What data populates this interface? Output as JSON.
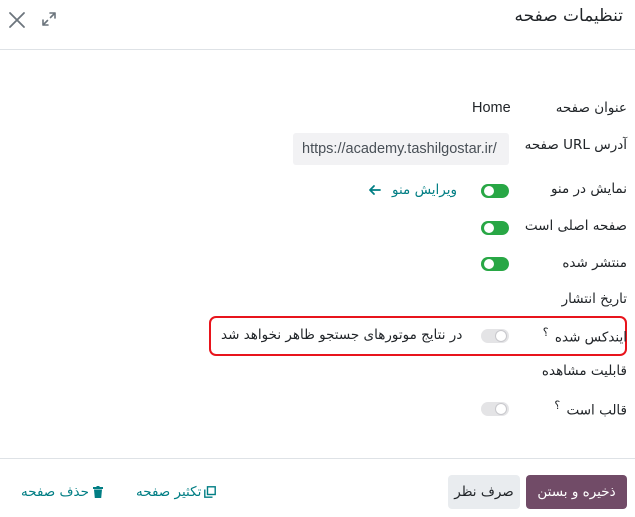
{
  "dialog": {
    "title": "تنظیمات صفحه"
  },
  "fields": {
    "page_title_label": "عنوان صفحه",
    "page_title_value": "Home",
    "url_label": "آدرس URL صفحه",
    "url_value": "https://academy.tashilgostar.ir/",
    "show_in_menu_label": "نمایش در منو",
    "show_in_menu_on": true,
    "edit_menu_label": "ویرایش منو",
    "homepage_label": "صفحه اصلی است",
    "homepage_on": true,
    "published_label": "منتشر شده",
    "published_on": true,
    "publish_date_label": "تاریخ انتشار",
    "indexed_label": "ایندکس شده",
    "indexed_hint": "؟",
    "indexed_on": false,
    "indexed_description": "در نتایج موتورهای جستجو ظاهر نخواهد شد",
    "visibility_label": "قابلیت مشاهده",
    "template_label": "قالب است",
    "template_hint": "؟",
    "template_on": false
  },
  "footer": {
    "save_close_label": "ذخیره و بستن",
    "discard_label": "صرف نظر",
    "duplicate_label": "تکثیر صفحه",
    "delete_label": "حذف صفحه"
  },
  "colors": {
    "primary": "#714b67",
    "toggle_on": "#28a745",
    "link": "#017e84",
    "highlight": "#e8141c"
  },
  "icons": {
    "close": "close-icon",
    "expand": "expand-icon",
    "arrow": "arrow-right-icon",
    "duplicate": "duplicate-icon",
    "delete": "trash-icon"
  }
}
